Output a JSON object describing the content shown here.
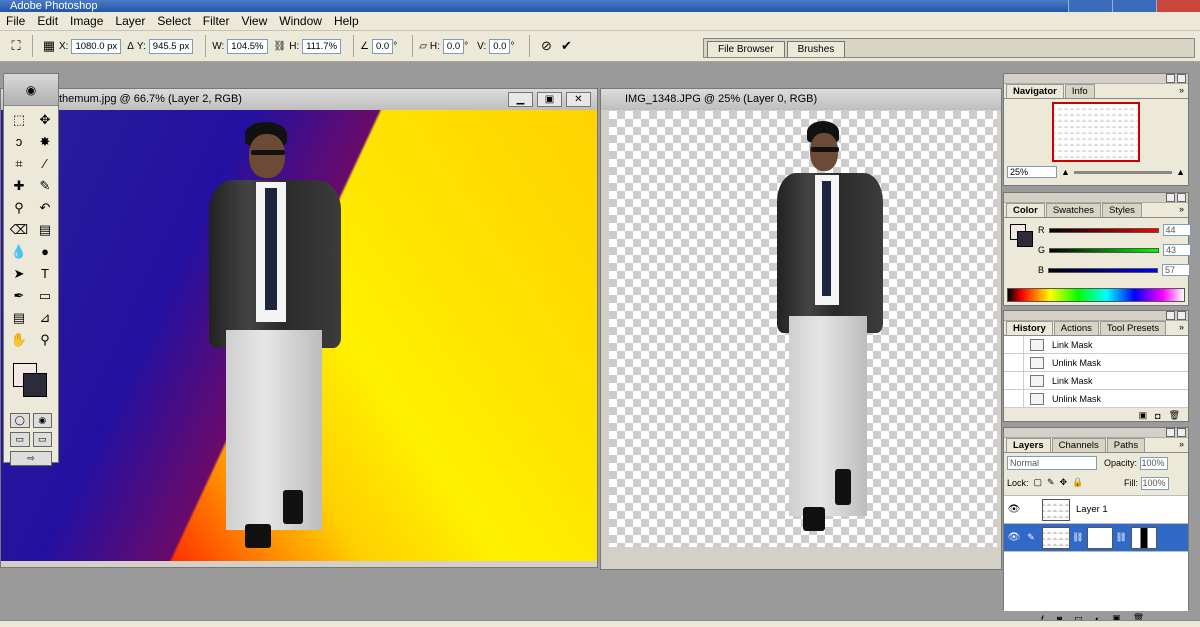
{
  "app": {
    "title": "Adobe Photoshop"
  },
  "menu": [
    "File",
    "Edit",
    "Image",
    "Layer",
    "Select",
    "Filter",
    "View",
    "Window",
    "Help"
  ],
  "options": {
    "x_label": "X:",
    "x_value": "1080.0 px",
    "y_label": "Y:",
    "y_value": "945.5 px",
    "w_label": "W:",
    "w_value": "104.5%",
    "h_label": "H:",
    "h_value": "111.7%",
    "rotate_value": "0.0",
    "hskew_label": "H:",
    "hskew_value": "0.0",
    "vskew_label": "V:",
    "vskew_value": "0.0"
  },
  "palette_well": {
    "tabs": [
      "File Browser",
      "Brushes"
    ]
  },
  "doc1": {
    "title": "themum.jpg @ 66.7% (Layer 2, RGB)"
  },
  "doc2": {
    "title": "IMG_1348.JPG @ 25% (Layer 0, RGB)"
  },
  "navigator": {
    "tabs": [
      "Navigator",
      "Info"
    ],
    "zoom": "25%"
  },
  "color": {
    "tabs": [
      "Color",
      "Swatches",
      "Styles"
    ],
    "channels": [
      {
        "label": "R",
        "value": "44",
        "color": "#cc0000"
      },
      {
        "label": "G",
        "value": "43",
        "color": "#00aa00"
      },
      {
        "label": "B",
        "value": "57",
        "color": "#0000cc"
      }
    ],
    "foreground": "#f3e8e6",
    "background": "#2c2b39"
  },
  "history": {
    "tabs": [
      "History",
      "Actions",
      "Tool Presets"
    ],
    "items": [
      "Link Mask",
      "Unlink Mask",
      "Link Mask",
      "Unlink Mask"
    ]
  },
  "layers": {
    "tabs": [
      "Layers",
      "Channels",
      "Paths"
    ],
    "blend_mode": "Normal",
    "opacity_label": "Opacity:",
    "opacity": "100%",
    "lock_label": "Lock:",
    "fill_label": "Fill:",
    "fill": "100%",
    "items": [
      {
        "name": "Layer 1"
      }
    ]
  }
}
